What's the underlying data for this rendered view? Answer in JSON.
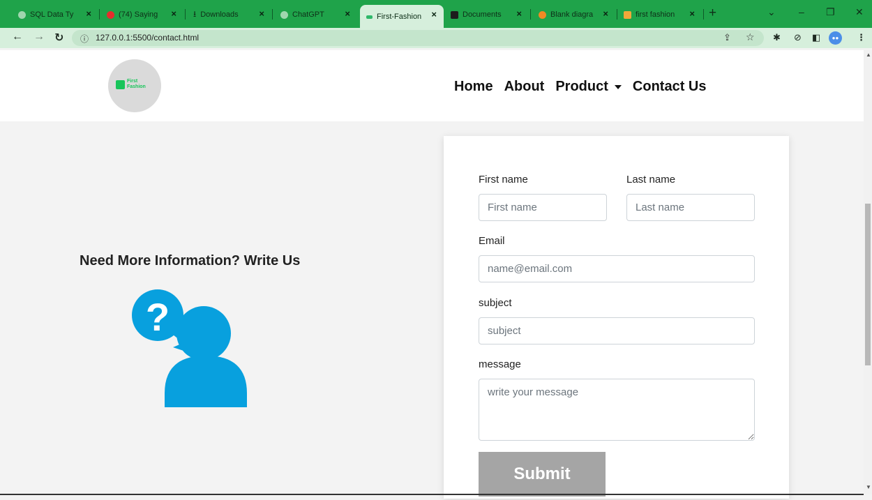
{
  "browser": {
    "tabs": [
      {
        "title": "SQL Data Ty",
        "fav_color": "#9fd6ae"
      },
      {
        "title": "(74) Saying",
        "fav_color": "#e62d2d"
      },
      {
        "title": "Downloads",
        "fav_color": "#0e2f18"
      },
      {
        "title": "ChatGPT",
        "fav_color": "#9fd6ae"
      },
      {
        "title": "First-Fashion",
        "fav_color": "#2fb86a"
      },
      {
        "title": "Documents",
        "fav_color": "#1d1d1d"
      },
      {
        "title": "Blank diagra",
        "fav_color": "#f08a24"
      },
      {
        "title": "first fashion",
        "fav_color": "#f2a83a"
      }
    ],
    "active_tab_index": 4,
    "close_glyph": "×",
    "new_tab_glyph": "+",
    "url": "127.0.0.1:5500/contact.html"
  },
  "header": {
    "logo_text_line1": "First",
    "logo_text_line2": "Fashion",
    "nav": {
      "home": "Home",
      "about": "About",
      "product": "Product",
      "contact": "Contact Us"
    }
  },
  "left": {
    "heading": "Need More Information? Write Us",
    "illustration_icon": "question-person-icon",
    "illustration_color": "#08a0de"
  },
  "form": {
    "first_name_label": "First name",
    "first_name_placeholder": "First name",
    "last_name_label": "Last name",
    "last_name_placeholder": "Last name",
    "email_label": "Email",
    "email_placeholder": "name@email.com",
    "subject_label": "subject",
    "subject_placeholder": "subject",
    "message_label": "message",
    "message_placeholder": "write your message",
    "submit_label": "Submit"
  },
  "colors": {
    "chrome_accent": "#1fa34a",
    "submit_bg": "#a5a5a5",
    "brand_green": "#18c55a"
  }
}
